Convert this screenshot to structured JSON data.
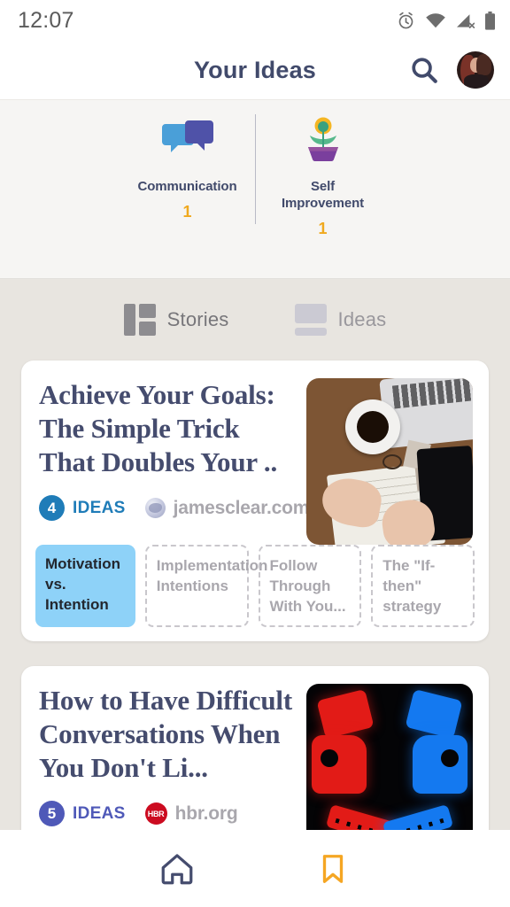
{
  "status_bar": {
    "time": "12:07",
    "icons": [
      "alarm-icon",
      "wifi-icon",
      "cellular-no-signal-icon",
      "battery-icon"
    ]
  },
  "app_bar": {
    "title": "Your Ideas",
    "search_icon": "search-icon",
    "avatar": "user-avatar"
  },
  "categories": [
    {
      "label": "Communication",
      "count": "1",
      "icon": "speech-bubbles-icon"
    },
    {
      "label": "Self Improvement",
      "count": "1",
      "icon": "potted-plant-icon"
    }
  ],
  "tabs": [
    {
      "label": "Stories",
      "icon": "layout-grid-icon",
      "active": true
    },
    {
      "label": "Ideas",
      "icon": "card-list-icon",
      "active": false
    }
  ],
  "cards": [
    {
      "title": "Achieve Your Goals: The Simple Trick That Doubles Your ..",
      "ideas_count": "4",
      "ideas_label": "IDEAS",
      "badge_color": "#1f7cb8",
      "source": "jamesclear.com",
      "favicon": "globe-favicon",
      "thumbnail": "desk-coffee-notebook-photo",
      "chips": [
        {
          "label": "Motivation vs. Intention",
          "active": true
        },
        {
          "label": "Implementation Intentions",
          "active": false
        },
        {
          "label": "Follow Through With You...",
          "active": false
        },
        {
          "label": "The \"If-then\" strategy",
          "active": false
        }
      ]
    },
    {
      "title": "How to Have Difficult Conversations When You Don't Li...",
      "ideas_count": "5",
      "ideas_label": "IDEAS",
      "badge_color": "#4f59b8",
      "source": "hbr.org",
      "favicon": "hbr-favicon",
      "favicon_text": "HBR",
      "thumbnail": "red-blue-figures-facing-off-photo"
    }
  ],
  "bottom_nav": [
    {
      "icon": "home-icon",
      "color": "#454c6e",
      "active": false
    },
    {
      "icon": "bookmark-icon",
      "color": "#f5a623",
      "active": true
    }
  ],
  "colors": {
    "accent_orange": "#f0a91e",
    "title_navy": "#414a6b",
    "chip_active_bg": "#8ed2f8",
    "page_bg": "#e8e5e0",
    "categories_bg": "#f6f5f3"
  }
}
